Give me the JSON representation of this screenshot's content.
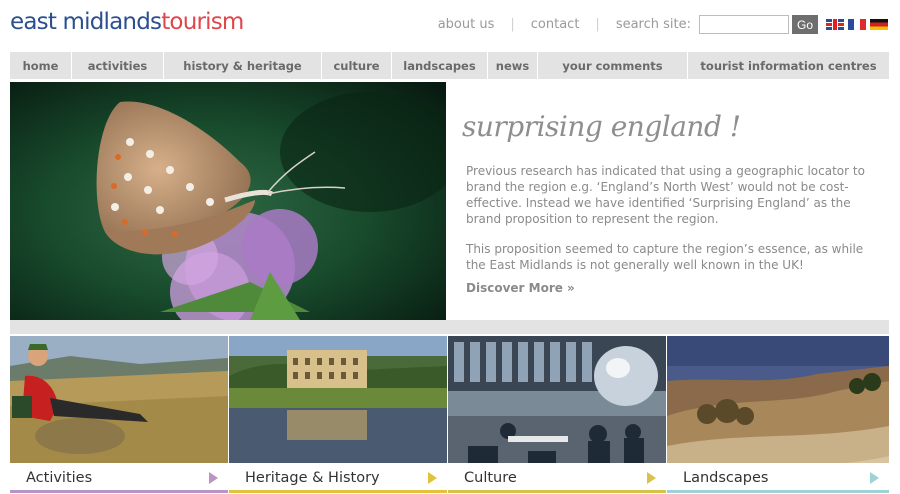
{
  "logo": {
    "part1": "east midlands",
    "part2": "tourism"
  },
  "toplinks": {
    "about": "about us",
    "contact": "contact",
    "search_label": "search site:",
    "search_value": "",
    "go": "Go"
  },
  "flags": [
    "uk-flag-icon",
    "france-flag-icon",
    "germany-flag-icon"
  ],
  "nav": [
    "home",
    "activities",
    "history & heritage",
    "culture",
    "landscapes",
    "news",
    "your comments",
    "tourist information centres"
  ],
  "hero": {
    "title": "surprising england !",
    "p1": "Previous research has indicated that using a geographic locator to brand the region e.g. ‘England’s North West’ would not be cost-effective.  Instead we have identified ‘Surprising England’ as the brand proposition to represent the region.",
    "p2": "This proposition seemed to capture the region’s essence, as while the East Midlands is not generally well known in the UK!",
    "discover": "Discover More »"
  },
  "tiles": [
    {
      "label": "Activities",
      "accent": "#b994c4"
    },
    {
      "label": "Heritage & History",
      "accent": "#e2c23a"
    },
    {
      "label": "Culture",
      "accent": "#d7c24c"
    },
    {
      "label": "Landscapes",
      "accent": "#9fd2d6"
    }
  ],
  "colors": {
    "brand_blue": "#2c4f8f",
    "brand_red": "#e0464a",
    "nav_bg": "#e3e3e3"
  }
}
